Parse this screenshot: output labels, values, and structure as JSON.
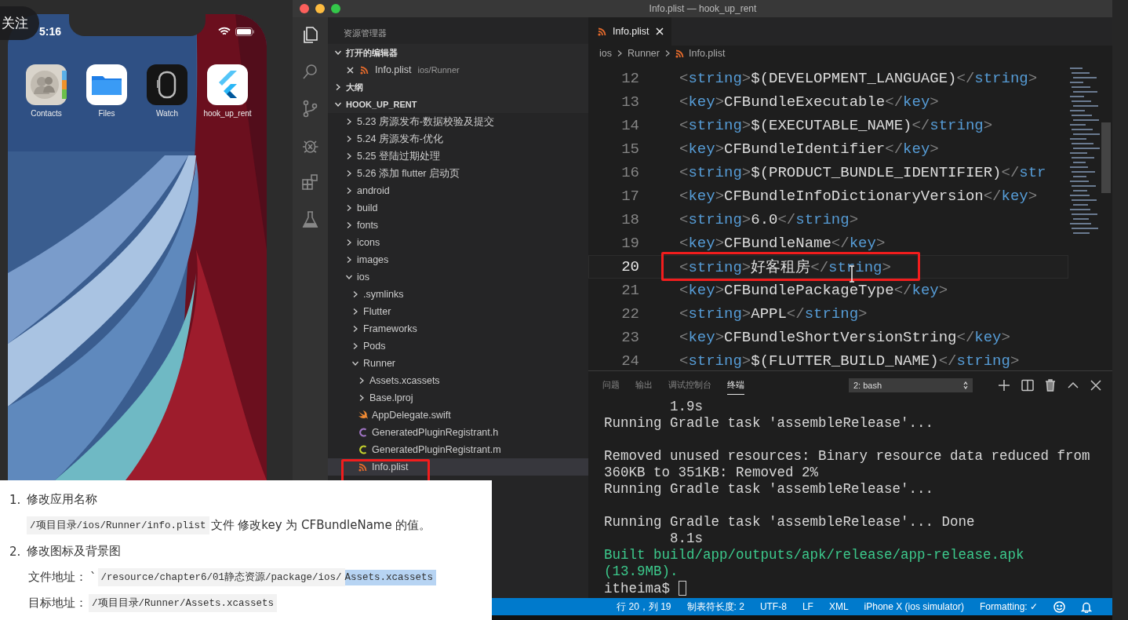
{
  "overlay": {
    "follow_button": "关注"
  },
  "phone": {
    "time": "5:16",
    "apps": [
      {
        "label": "Contacts",
        "kind": "contacts"
      },
      {
        "label": "Files",
        "kind": "files"
      },
      {
        "label": "Watch",
        "kind": "watch"
      },
      {
        "label": "hook_up_rent",
        "kind": "flutter"
      }
    ]
  },
  "window": {
    "title": "Info.plist — hook_up_rent"
  },
  "activity_bar": [
    {
      "kind": "files",
      "selected": true
    },
    {
      "kind": "search",
      "selected": false
    },
    {
      "kind": "scm",
      "selected": false
    },
    {
      "kind": "debug",
      "selected": false
    },
    {
      "kind": "extensions",
      "selected": false
    },
    {
      "kind": "test",
      "selected": false
    }
  ],
  "sidebar": {
    "title": "资源管理器",
    "open_editors": {
      "label": "打开的编辑器",
      "expanded": true,
      "items": [
        {
          "name": "Info.plist",
          "path": "ios/Runner"
        }
      ]
    },
    "outline": {
      "label": "大纲",
      "expanded": false
    },
    "project": {
      "label": "HOOK_UP_RENT",
      "expanded": true,
      "tree": [
        {
          "name": "5.23 房源发布-数据校验及提交",
          "kind": "folder",
          "expanded": false,
          "selected": false
        },
        {
          "name": "5.24 房源发布-优化",
          "kind": "folder",
          "expanded": false,
          "selected": false
        },
        {
          "name": "5.25 登陆过期处理",
          "kind": "folder",
          "expanded": false,
          "selected": false
        },
        {
          "name": "5.26 添加 flutter 启动页",
          "kind": "folder",
          "expanded": false,
          "selected": false
        },
        {
          "name": "android",
          "kind": "folder",
          "expanded": false,
          "selected": false
        },
        {
          "name": "build",
          "kind": "folder",
          "expanded": false,
          "selected": false
        },
        {
          "name": "fonts",
          "kind": "folder",
          "expanded": false,
          "selected": false
        },
        {
          "name": "icons",
          "kind": "folder",
          "expanded": false,
          "selected": false
        },
        {
          "name": "images",
          "kind": "folder",
          "expanded": false,
          "selected": false
        },
        {
          "name": "ios",
          "kind": "folder",
          "expanded": true,
          "selected": false,
          "children": [
            {
              "name": ".symlinks",
              "kind": "folder",
              "expanded": false,
              "selected": false
            },
            {
              "name": "Flutter",
              "kind": "folder",
              "expanded": false,
              "selected": false
            },
            {
              "name": "Frameworks",
              "kind": "folder",
              "expanded": false,
              "selected": false
            },
            {
              "name": "Pods",
              "kind": "folder",
              "expanded": false,
              "selected": false
            },
            {
              "name": "Runner",
              "kind": "folder",
              "expanded": true,
              "selected": false,
              "children": [
                {
                  "name": "Assets.xcassets",
                  "kind": "folder",
                  "expanded": false,
                  "selected": false
                },
                {
                  "name": "Base.lproj",
                  "kind": "folder",
                  "expanded": false,
                  "selected": false
                },
                {
                  "name": "AppDelegate.swift",
                  "kind": "swift",
                  "selected": false
                },
                {
                  "name": "GeneratedPluginRegistrant.h",
                  "kind": "c-header",
                  "selected": false
                },
                {
                  "name": "GeneratedPluginRegistrant.m",
                  "kind": "c-source",
                  "selected": false
                },
                {
                  "name": "Info.plist",
                  "kind": "plist",
                  "selected": true
                }
              ]
            }
          ]
        }
      ]
    }
  },
  "editor": {
    "tabs": [
      {
        "label": "Info.plist",
        "selected": true
      }
    ],
    "breadcrumb": [
      "ios",
      "Runner",
      "Info.plist"
    ],
    "lines": [
      {
        "number": "12",
        "text": "<string>$(DEVELOPMENT_LANGUAGE)</string>",
        "current": false
      },
      {
        "number": "13",
        "text": "<key>CFBundleExecutable</key>",
        "current": false
      },
      {
        "number": "14",
        "text": "<string>$(EXECUTABLE_NAME)</string>",
        "current": false
      },
      {
        "number": "15",
        "text": "<key>CFBundleIdentifier</key>",
        "current": false
      },
      {
        "number": "16",
        "text": "<string>$(PRODUCT_BUNDLE_IDENTIFIER)</str",
        "current": false
      },
      {
        "number": "17",
        "text": "<key>CFBundleInfoDictionaryVersion</key>",
        "current": false
      },
      {
        "number": "18",
        "text": "<string>6.0</string>",
        "current": false
      },
      {
        "number": "19",
        "text": "<key>CFBundleName</key>",
        "current": false
      },
      {
        "number": "20",
        "text": "<string>好客租房</string>",
        "current": true
      },
      {
        "number": "21",
        "text": "<key>CFBundlePackageType</key>",
        "current": false
      },
      {
        "number": "22",
        "text": "<string>APPL</string>",
        "current": false
      },
      {
        "number": "23",
        "text": "<key>CFBundleShortVersionString</key>",
        "current": false
      },
      {
        "number": "24",
        "text": "<string>$(FLUTTER_BUILD_NAME)</string>",
        "current": false
      }
    ]
  },
  "panel": {
    "tabs": [
      {
        "label": "问题",
        "selected": false
      },
      {
        "label": "输出",
        "selected": false
      },
      {
        "label": "调试控制台",
        "selected": false
      },
      {
        "label": "终端",
        "selected": true
      }
    ],
    "terminal_select": "2: bash",
    "blocks": [
      [
        {
          "text": "        1.9s",
          "kind": "output"
        },
        {
          "text": "Running Gradle task 'assembleRelease'...",
          "kind": "output"
        }
      ],
      [
        {
          "text": "Removed unused resources: Binary resource data reduced from",
          "kind": "output"
        },
        {
          "text": "360KB to 351KB: Removed 2%",
          "kind": "output"
        },
        {
          "text": "Running Gradle task 'assembleRelease'...",
          "kind": "output"
        }
      ],
      [
        {
          "text": "Running Gradle task 'assembleRelease'... Done",
          "kind": "output"
        },
        {
          "text": "        8.1s",
          "kind": "output"
        },
        {
          "text": "Built build/app/outputs/apk/release/app-release.apk",
          "kind": "success"
        },
        {
          "text": "(13.9MB).",
          "kind": "success"
        }
      ]
    ],
    "prompt": "itheima$"
  },
  "status_bar": [
    "行 20，列 19",
    "制表符长度: 2",
    "UTF-8",
    "LF",
    "XML",
    "iPhone X (ios simulator)",
    "Formatting: ✓"
  ],
  "notes": {
    "steps": [
      {
        "number": "1.",
        "title": "修改应用名称",
        "lines": [
          [
            {
              "kind": "code",
              "text": "/项目目录/ios/Runner/info.plist",
              "highlighted": false
            },
            {
              "kind": "text",
              "text": "文件 修改key 为 CFBundleName 的值。",
              "highlighted": false
            }
          ]
        ]
      },
      {
        "number": "2.",
        "title": "修改图标及背景图",
        "lines": [
          [
            {
              "kind": "text",
              "text": "文件地址：",
              "highlighted": false
            },
            {
              "kind": "text",
              "text": "`",
              "highlighted": false
            },
            {
              "kind": "code",
              "text": "/resource/chapter6/01静态资源/package/ios/",
              "highlighted": false
            },
            {
              "kind": "code",
              "text": "Assets.xcassets",
              "highlighted": true
            }
          ],
          [
            {
              "kind": "text",
              "text": "目标地址：",
              "highlighted": false
            },
            {
              "kind": "code",
              "text": "/项目目录/Runner/Assets.xcassets",
              "highlighted": false
            }
          ]
        ]
      }
    ]
  }
}
